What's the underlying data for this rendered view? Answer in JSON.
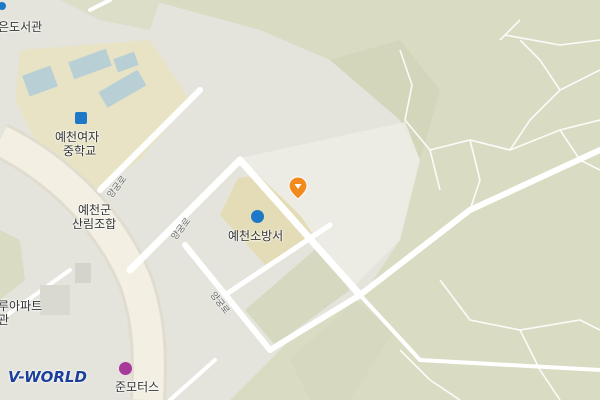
{
  "map": {
    "colors": {
      "forest": "#d9dcc2",
      "urban": "#e6e6de",
      "building": "#cfd1c4",
      "road": "#ffffff",
      "school_zone": "#e7e3c4",
      "firestation_zone": "#e3dcb6",
      "poi_blue": "#1e78c8",
      "poi_purple": "#a83a9a",
      "pin_orange": "#f28a1e"
    },
    "labels": {
      "library": "은도서관",
      "school_line1": "예천여자",
      "school_line2": "중학교",
      "cooperative_line1": "예천군",
      "cooperative_line2": "산림조합",
      "fire_station": "예천소방서",
      "apartment_line1": "루아파트",
      "apartment_line2": "관",
      "motors": "준모터스"
    },
    "road_labels": {
      "road_a": "양궁로",
      "road_b": "양궁로",
      "road_c": "양궁로"
    },
    "icons": {
      "library": "library-icon",
      "school": "school-icon",
      "fire_station": "fire-station-icon",
      "motors": "car-repair-icon",
      "marker": "location-pin-icon"
    },
    "brand": "V-WORLD"
  }
}
